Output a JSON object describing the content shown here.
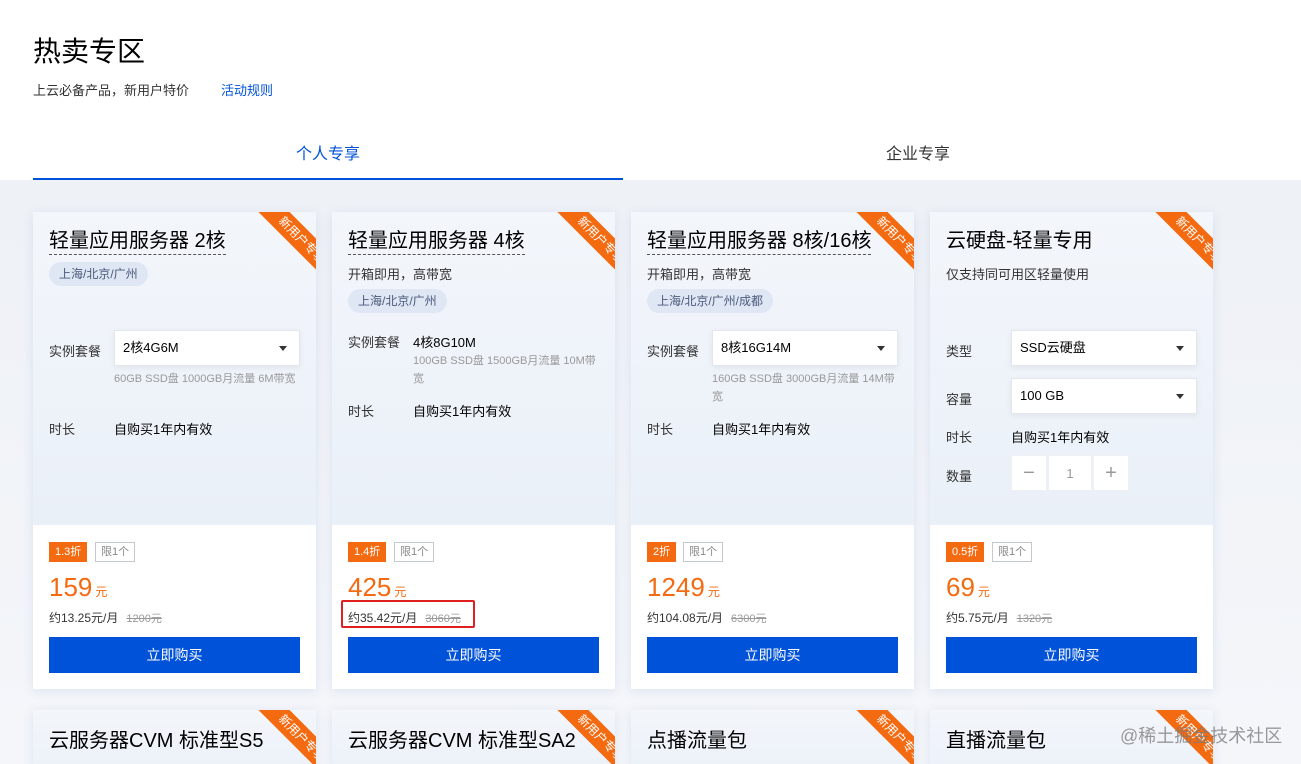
{
  "header": {
    "title": "热卖专区",
    "subtitle": "上云必备产品，新用户特价",
    "rules_link": "活动规则"
  },
  "tabs": [
    {
      "label": "个人专享",
      "active": true
    },
    {
      "label": "企业专享",
      "active": false
    }
  ],
  "ribbon_text": "新用户专享",
  "accent_color": "#0052d9",
  "discount_color": "#f46a11",
  "cards": [
    {
      "title": "轻量应用服务器 2核",
      "region": "上海/北京/广州",
      "package_label": "实例套餐",
      "package_value": "2核4G6M",
      "package_note": "60GB SSD盘 1000GB月流量 6M带宽",
      "duration_label": "时长",
      "duration_value": "自购买1年内有效",
      "discount": "1.3折",
      "limit": "限1个",
      "price": "159",
      "price_unit": "元",
      "monthly": "约13.25元/月",
      "original": "1200元",
      "buy": "立即购买"
    },
    {
      "title": "轻量应用服务器 4核",
      "desc": "开箱即用，高带宽",
      "region": "上海/北京/广州",
      "package_label": "实例套餐",
      "package_value": "4核8G10M",
      "package_note": "100GB SSD盘 1500GB月流量 10M带宽",
      "duration_label": "时长",
      "duration_value": "自购买1年内有效",
      "discount": "1.4折",
      "limit": "限1个",
      "price": "425",
      "price_unit": "元",
      "monthly": "约35.42元/月",
      "original": "3060元",
      "buy": "立即购买"
    },
    {
      "title": "轻量应用服务器 8核/16核",
      "desc": "开箱即用，高带宽",
      "region": "上海/北京/广州/成都",
      "package_label": "实例套餐",
      "package_value": "8核16G14M",
      "package_note": "160GB SSD盘 3000GB月流量 14M带宽",
      "duration_label": "时长",
      "duration_value": "自购买1年内有效",
      "discount": "2折",
      "limit": "限1个",
      "price": "1249",
      "price_unit": "元",
      "monthly": "约104.08元/月",
      "original": "6300元",
      "buy": "立即购买"
    },
    {
      "title": "云硬盘-轻量专用",
      "desc": "仅支持同可用区轻量使用",
      "type_label": "类型",
      "type_value": "SSD云硬盘",
      "capacity_label": "容量",
      "capacity_value": "100 GB",
      "duration_label": "时长",
      "duration_value": "自购买1年内有效",
      "quantity_label": "数量",
      "quantity_value": "1",
      "minus": "−",
      "plus": "+",
      "discount": "0.5折",
      "limit": "限1个",
      "price": "69",
      "price_unit": "元",
      "monthly": "约5.75元/月",
      "original": "1320元",
      "buy": "立即购买"
    }
  ],
  "row2": [
    {
      "title": "云服务器CVM 标准型S5"
    },
    {
      "title": "云服务器CVM 标准型SA2"
    },
    {
      "title": "点播流量包"
    },
    {
      "title": "直播流量包"
    }
  ],
  "watermark": "@稀土掘金技术社区"
}
